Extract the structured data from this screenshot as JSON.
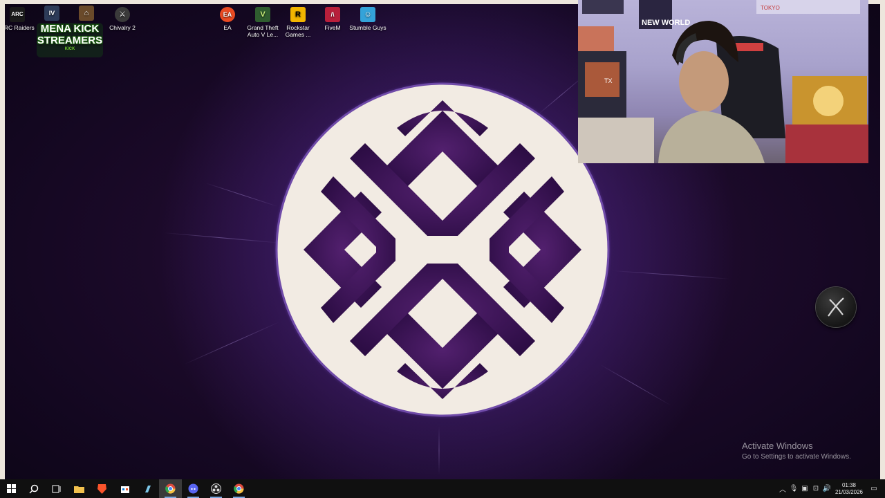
{
  "desktop": {
    "icons": [
      {
        "label": "ARC Raiders",
        "glyph": "A",
        "color": "#1a1a1a",
        "fg": "#ffffff"
      },
      {
        "label": "",
        "glyph": "IV",
        "color": "#2d3b58",
        "fg": "#ffffff"
      },
      {
        "label": "",
        "glyph": "⌂",
        "color": "#6a4a2a",
        "fg": "#ffffff"
      },
      {
        "label": "Chivalry 2",
        "glyph": "⚔",
        "color": "#3a3a3a",
        "fg": "#ffffff"
      },
      {
        "label": "EA",
        "glyph": "EA",
        "color": "#e94b22",
        "fg": "#ffffff"
      },
      {
        "label": "Grand Theft Auto V Le...",
        "glyph": "V",
        "color": "#2f5d2f",
        "fg": "#c9f07a"
      },
      {
        "label": "Rockstar Games ...",
        "glyph": "R",
        "color": "#f2b500",
        "fg": "#000000"
      },
      {
        "label": "FiveM",
        "glyph": "/\\",
        "color": "#b81f3b",
        "fg": "#ffffff"
      },
      {
        "label": "Stumble Guys",
        "glyph": "☺",
        "color": "#34a3d9",
        "fg": "#ffffff"
      }
    ],
    "overlay_logo": {
      "line1": "MENA KICK",
      "line2": "STREAMERS",
      "sub": "KICK"
    },
    "activation": {
      "title": "Activate Windows",
      "subtitle": "Go to Settings to activate Windows."
    }
  },
  "webcam": {
    "poster_text": "NEW WORLD",
    "shelf_text": "TOKYO",
    "pc_text": "TX"
  },
  "colors": {
    "emblem_ring": "#f2ebe3",
    "emblem_purple": "#3d1456",
    "taskbar": "#101010",
    "accent": "#7aa7e0"
  },
  "taskbar": {
    "items": [
      {
        "name": "start-button",
        "icon": "windows-icon"
      },
      {
        "name": "search-button",
        "icon": "search-icon"
      },
      {
        "name": "task-view-button",
        "icon": "task-view-icon"
      },
      {
        "name": "file-explorer-button",
        "icon": "folder-icon"
      },
      {
        "name": "brave-button",
        "icon": "brave-icon"
      },
      {
        "name": "store-button",
        "icon": "store-icon"
      },
      {
        "name": "app-button",
        "icon": "app-icon"
      },
      {
        "name": "chrome-button",
        "icon": "chrome-icon"
      },
      {
        "name": "discord-button",
        "icon": "discord-icon"
      },
      {
        "name": "obs-button",
        "icon": "obs-icon"
      },
      {
        "name": "chrome-2-button",
        "icon": "chrome-icon"
      }
    ],
    "tray": {
      "time": "01:38",
      "date": "21/03/2026"
    }
  }
}
